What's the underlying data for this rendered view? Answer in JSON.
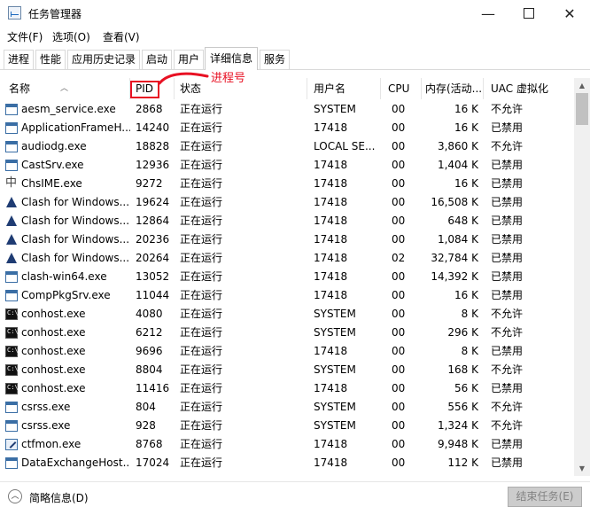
{
  "window": {
    "title": "任务管理器"
  },
  "menu": [
    "文件(F)",
    "选项(O)",
    "查看(V)"
  ],
  "tabs": [
    "进程",
    "性能",
    "应用历史记录",
    "启动",
    "用户",
    "详细信息",
    "服务"
  ],
  "annotation": {
    "label": "进程号"
  },
  "columns": [
    "名称",
    "PID",
    "状态",
    "用户名",
    "CPU",
    "内存(活动...",
    "UAC 虚拟化"
  ],
  "processes": [
    {
      "name": "aesm_service.exe",
      "pid": "2868",
      "status": "正在运行",
      "user": "SYSTEM",
      "cpu": "00",
      "mem": "16 K",
      "uac": "不允许",
      "icon": "window"
    },
    {
      "name": "ApplicationFrameH...",
      "pid": "14240",
      "status": "正在运行",
      "user": "17418",
      "cpu": "00",
      "mem": "16 K",
      "uac": "已禁用",
      "icon": "window"
    },
    {
      "name": "audiodg.exe",
      "pid": "18828",
      "status": "正在运行",
      "user": "LOCAL SE...",
      "cpu": "00",
      "mem": "3,860 K",
      "uac": "不允许",
      "icon": "window"
    },
    {
      "name": "CastSrv.exe",
      "pid": "12936",
      "status": "正在运行",
      "user": "17418",
      "cpu": "00",
      "mem": "1,404 K",
      "uac": "已禁用",
      "icon": "window"
    },
    {
      "name": "ChsIME.exe",
      "pid": "9272",
      "status": "正在运行",
      "user": "17418",
      "cpu": "00",
      "mem": "16 K",
      "uac": "已禁用",
      "icon": "ime"
    },
    {
      "name": "Clash for Windows...",
      "pid": "19624",
      "status": "正在运行",
      "user": "17418",
      "cpu": "00",
      "mem": "16,508 K",
      "uac": "已禁用",
      "icon": "clash"
    },
    {
      "name": "Clash for Windows...",
      "pid": "12864",
      "status": "正在运行",
      "user": "17418",
      "cpu": "00",
      "mem": "648 K",
      "uac": "已禁用",
      "icon": "clash"
    },
    {
      "name": "Clash for Windows...",
      "pid": "20236",
      "status": "正在运行",
      "user": "17418",
      "cpu": "00",
      "mem": "1,084 K",
      "uac": "已禁用",
      "icon": "clash"
    },
    {
      "name": "Clash for Windows...",
      "pid": "20264",
      "status": "正在运行",
      "user": "17418",
      "cpu": "02",
      "mem": "32,784 K",
      "uac": "已禁用",
      "icon": "clash"
    },
    {
      "name": "clash-win64.exe",
      "pid": "13052",
      "status": "正在运行",
      "user": "17418",
      "cpu": "00",
      "mem": "14,392 K",
      "uac": "已禁用",
      "icon": "window"
    },
    {
      "name": "CompPkgSrv.exe",
      "pid": "11044",
      "status": "正在运行",
      "user": "17418",
      "cpu": "00",
      "mem": "16 K",
      "uac": "已禁用",
      "icon": "window"
    },
    {
      "name": "conhost.exe",
      "pid": "4080",
      "status": "正在运行",
      "user": "SYSTEM",
      "cpu": "00",
      "mem": "8 K",
      "uac": "不允许",
      "icon": "console"
    },
    {
      "name": "conhost.exe",
      "pid": "6212",
      "status": "正在运行",
      "user": "SYSTEM",
      "cpu": "00",
      "mem": "296 K",
      "uac": "不允许",
      "icon": "console"
    },
    {
      "name": "conhost.exe",
      "pid": "9696",
      "status": "正在运行",
      "user": "17418",
      "cpu": "00",
      "mem": "8 K",
      "uac": "已禁用",
      "icon": "console"
    },
    {
      "name": "conhost.exe",
      "pid": "8804",
      "status": "正在运行",
      "user": "SYSTEM",
      "cpu": "00",
      "mem": "168 K",
      "uac": "不允许",
      "icon": "console"
    },
    {
      "name": "conhost.exe",
      "pid": "11416",
      "status": "正在运行",
      "user": "17418",
      "cpu": "00",
      "mem": "56 K",
      "uac": "已禁用",
      "icon": "console"
    },
    {
      "name": "csrss.exe",
      "pid": "804",
      "status": "正在运行",
      "user": "SYSTEM",
      "cpu": "00",
      "mem": "556 K",
      "uac": "不允许",
      "icon": "window"
    },
    {
      "name": "csrss.exe",
      "pid": "928",
      "status": "正在运行",
      "user": "SYSTEM",
      "cpu": "00",
      "mem": "1,324 K",
      "uac": "不允许",
      "icon": "window"
    },
    {
      "name": "ctfmon.exe",
      "pid": "8768",
      "status": "正在运行",
      "user": "17418",
      "cpu": "00",
      "mem": "9,948 K",
      "uac": "已禁用",
      "icon": "pen"
    },
    {
      "name": "DataExchangeHost...",
      "pid": "17024",
      "status": "正在运行",
      "user": "17418",
      "cpu": "00",
      "mem": "112 K",
      "uac": "已禁用",
      "icon": "window"
    }
  ],
  "footer": {
    "fewer_details": "简略信息(D)",
    "end_task": "结束任务(E)"
  }
}
